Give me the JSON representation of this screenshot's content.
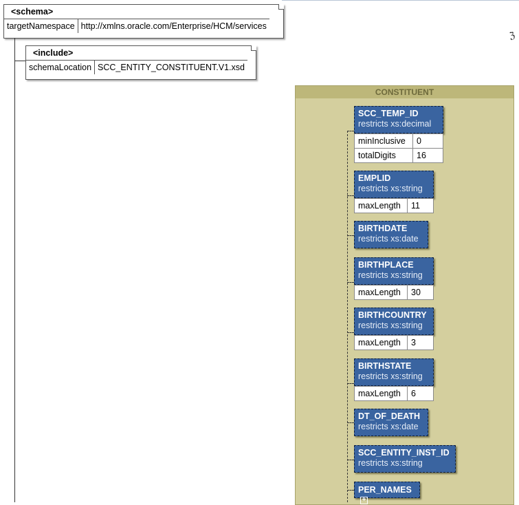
{
  "schema": {
    "header": "<schema>",
    "attr_name": "targetNamespace",
    "attr_value": "http://xmlns.oracle.com/Enterprise/HCM/services"
  },
  "include": {
    "header": "<include>",
    "attr_name": "schemaLocation",
    "attr_value": "SCC_ENTITY_CONSTITUENT.V1.xsd"
  },
  "complex_type": {
    "title": "CONSTITUENT"
  },
  "elements": [
    {
      "name": "SCC_TEMP_ID",
      "restricts": "restricts xs:decimal",
      "facets": [
        {
          "name": "minInclusive",
          "value": "0"
        },
        {
          "name": "totalDigits",
          "value": "16"
        }
      ]
    },
    {
      "name": "EMPLID",
      "restricts": "restricts xs:string",
      "facets": [
        {
          "name": "maxLength",
          "value": "11"
        }
      ]
    },
    {
      "name": "BIRTHDATE",
      "restricts": "restricts xs:date",
      "facets": []
    },
    {
      "name": "BIRTHPLACE",
      "restricts": "restricts xs:string",
      "facets": [
        {
          "name": "maxLength",
          "value": "30"
        }
      ]
    },
    {
      "name": "BIRTHCOUNTRY",
      "restricts": "restricts xs:string",
      "facets": [
        {
          "name": "maxLength",
          "value": "3"
        }
      ]
    },
    {
      "name": "BIRTHSTATE",
      "restricts": "restricts xs:string",
      "facets": [
        {
          "name": "maxLength",
          "value": "6"
        }
      ]
    },
    {
      "name": "DT_OF_DEATH",
      "restricts": "restricts xs:date",
      "facets": []
    },
    {
      "name": "SCC_ENTITY_INST_ID",
      "restricts": "restricts xs:string",
      "facets": []
    },
    {
      "name": "PER_NAMES",
      "restricts": "",
      "facets": [],
      "expandable": true
    }
  ],
  "icons": {
    "expand": "plus-icon"
  }
}
